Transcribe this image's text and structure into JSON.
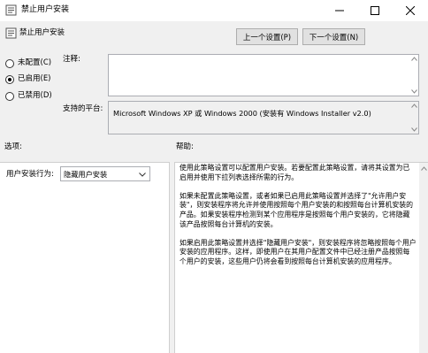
{
  "window": {
    "title": "禁止用户安装",
    "icon": "policy-icon",
    "controls": [
      "minimize-icon",
      "maximize-icon",
      "close-icon"
    ]
  },
  "header": {
    "policy_title": "禁止用户安装",
    "prev_button": "上一个设置(P)",
    "next_button": "下一个设置(N)"
  },
  "state": {
    "selected": "enabled",
    "options": [
      {
        "id": "not_configured",
        "label": "未配置(C)",
        "checked": false
      },
      {
        "id": "enabled",
        "label": "已启用(E)",
        "checked": true
      },
      {
        "id": "disabled",
        "label": "已禁用(D)",
        "checked": false
      }
    ]
  },
  "comment": {
    "label": "注释:",
    "value": ""
  },
  "platform": {
    "label": "支持的平台:",
    "value": "Microsoft Windows XP 或 Windows 2000 (安装有 Windows Installer v2.0)"
  },
  "sections": {
    "options_label": "选项:",
    "help_label": "帮助:"
  },
  "options": {
    "behavior_label": "用户安装行为:",
    "behavior_value": "隐藏用户安装"
  },
  "help": {
    "paragraphs": [
      "使用此策略设置可以配置用户安装。若要配置此策略设置，请将其设置为已启用并使用下拉列表选择所需的行为。",
      "如果未配置此策略设置，或者如果已启用此策略设置并选择了\"允许用户安装\"，则安装程序将允许并使用按照每个用户安装的和按照每台计算机安装的产品。如果安装程序检测到某个应用程序是按照每个用户安装的，它将隐藏该产品按照每台计算机的安装。",
      "如果启用此策略设置并选择\"隐藏用户安装\"，则安装程序将忽略按照每个用户安装的应用程序。这样，即使用户在其用户配置文件中已经注册产品按照每个用户的安装，这些用户仍将会看到按照每台计算机安装的应用程序。"
    ]
  },
  "colors": {
    "window_bg": "#f0f0f0",
    "panel_bg": "#ffffff",
    "border": "#adadad"
  }
}
